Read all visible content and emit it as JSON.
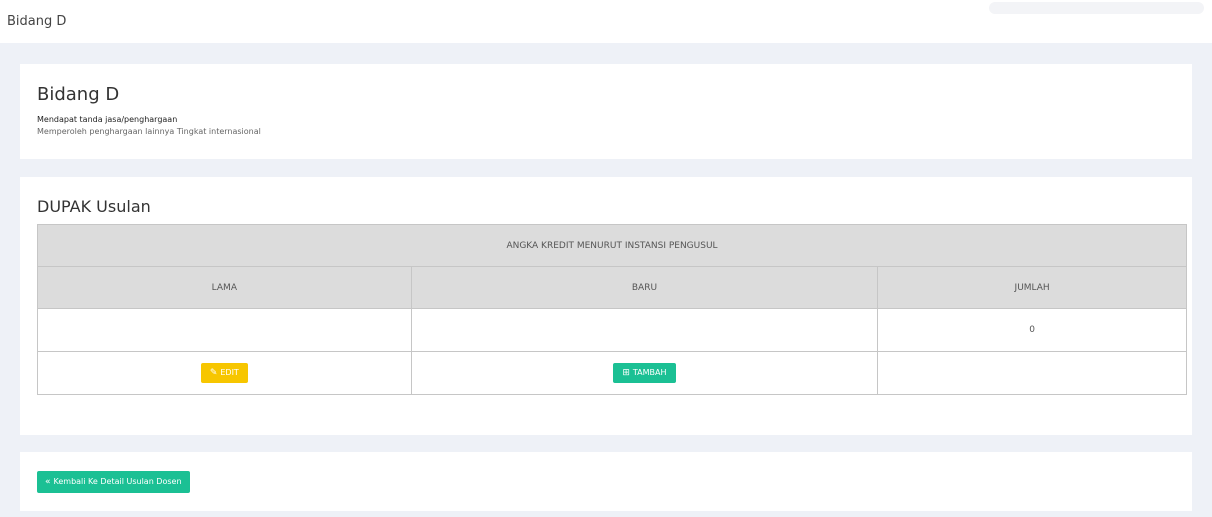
{
  "breadcrumb": "Bidang D",
  "info": {
    "title": "Bidang D",
    "line1": "Mendapat tanda jasa/penghargaan",
    "line2": "Memperoleh penghargaan lainnya Tingkat internasional"
  },
  "dupak": {
    "title": "DUPAK Usulan",
    "group_header": "ANGKA KREDIT MENURUT INSTANSI PENGUSUL",
    "columns": [
      "LAMA",
      "BARU",
      "JUMLAH"
    ],
    "row": {
      "lama": "",
      "baru": "",
      "jumlah": "0"
    },
    "edit_label": "EDIT",
    "add_label": "TAMBAH"
  },
  "back_label": "Kembali Ke Detail Usulan Dosen",
  "icons": {
    "edit": "edit-icon",
    "add": "plus-square-icon",
    "back": "double-chevron-left-icon"
  },
  "colors": {
    "edit": "#f7c600",
    "add": "#1bc094",
    "header": "#dcdcdc"
  }
}
